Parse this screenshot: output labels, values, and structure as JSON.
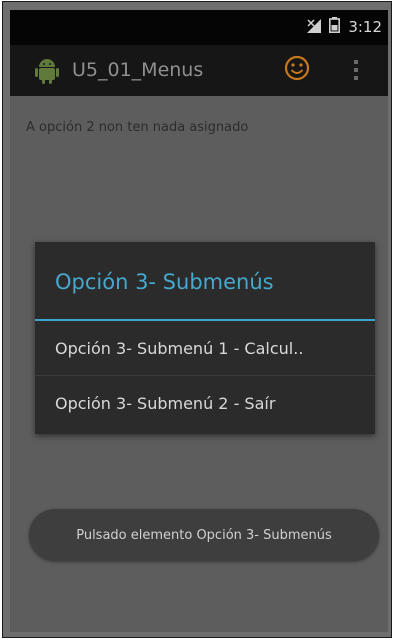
{
  "status_bar": {
    "time": "3:12",
    "icons": [
      "signal-icon",
      "battery-icon"
    ]
  },
  "action_bar": {
    "app_icon": "android-icon",
    "title": "U5_01_Menus",
    "action_icon": "smiley-icon",
    "overflow_icon": "overflow-menu-icon"
  },
  "content": {
    "message": "A opción 2 non ten nada asignado"
  },
  "dialog": {
    "title": "Opción 3- Submenús",
    "items": [
      {
        "label": "Opción 3- Submenú 1 - Calcul.."
      },
      {
        "label": "Opción 3- Submenú 2 - Saír"
      }
    ]
  },
  "toast": {
    "text": "Pulsado elemento Opción 3- Submenús"
  },
  "colors": {
    "accent": "#3aa3ce",
    "smiley": "#c87a1a"
  }
}
